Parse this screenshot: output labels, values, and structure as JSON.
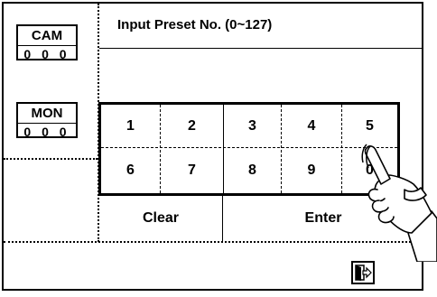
{
  "left_panel": {
    "cam": {
      "label": "CAM",
      "value": "0 0 0"
    },
    "mon": {
      "label": "MON",
      "value": "0 0 0"
    }
  },
  "header": {
    "title": "Input Preset No. (0~127)"
  },
  "keypad": {
    "row1": [
      "1",
      "2",
      "3",
      "4",
      "5"
    ],
    "row2": [
      "6",
      "7",
      "8",
      "9",
      "0"
    ]
  },
  "actions": {
    "clear": "Clear",
    "enter": "Enter"
  },
  "icons": {
    "exit": "exit-door-icon",
    "pointer": "pointing-hand-icon"
  }
}
